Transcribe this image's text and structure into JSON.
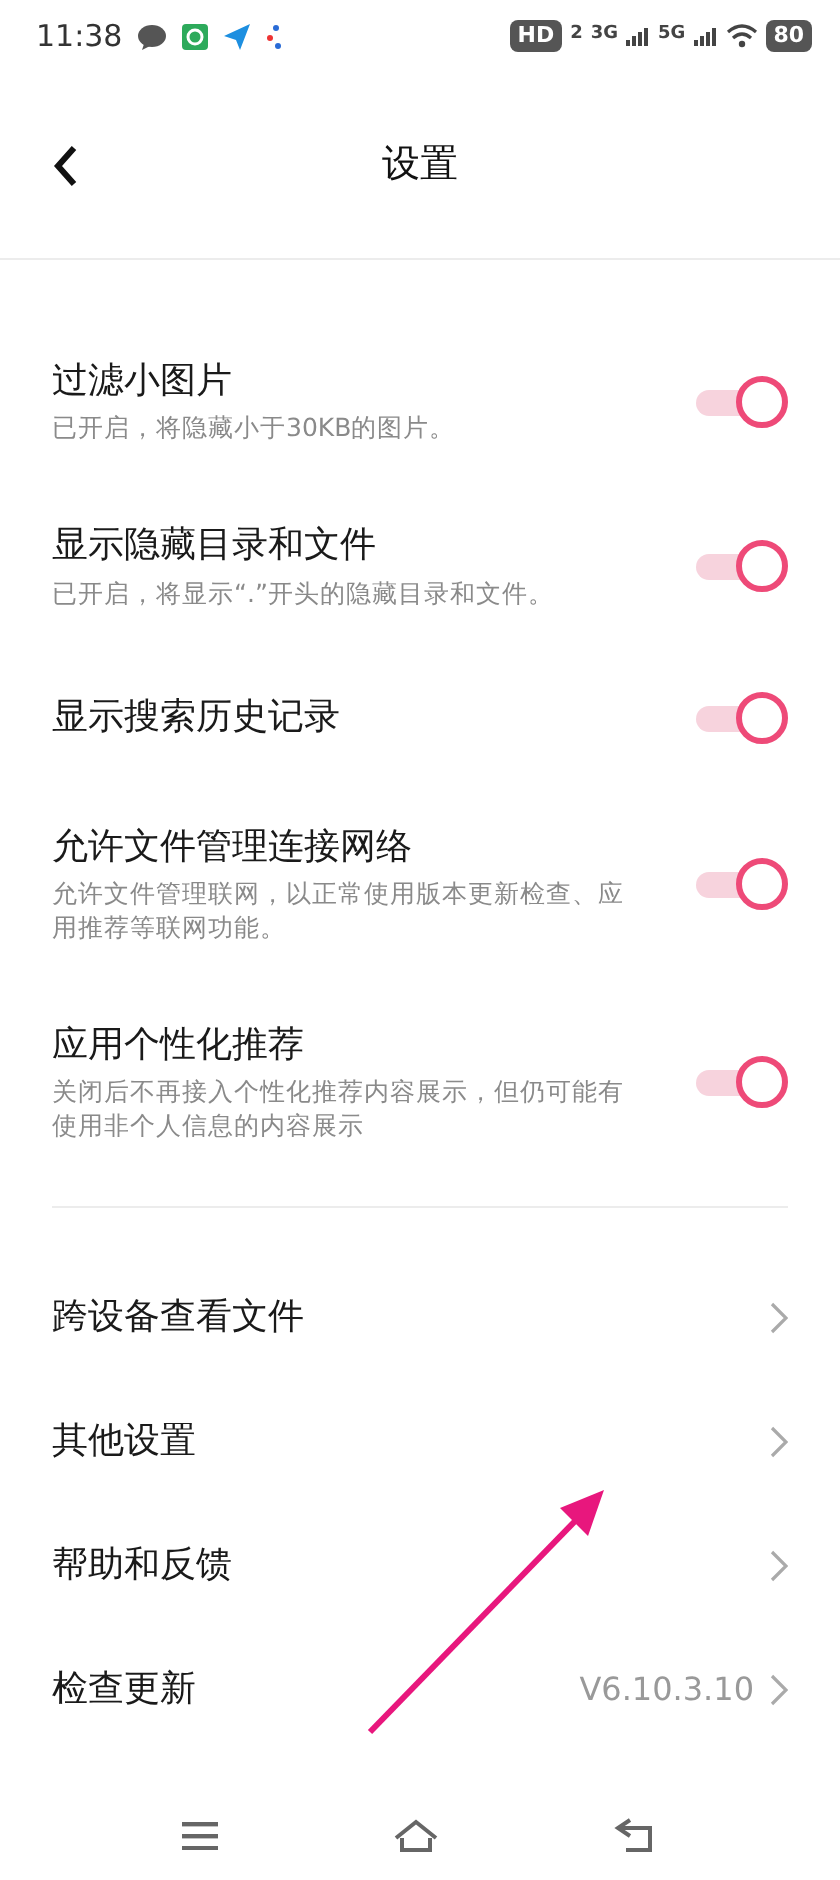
{
  "status_bar": {
    "time": "11:38",
    "hd": "HD",
    "hd_sub": "2",
    "networks": [
      "3G",
      "5G"
    ],
    "battery": "80"
  },
  "header": {
    "title": "设置"
  },
  "toggles": [
    {
      "title": "过滤小图片",
      "subtitle": "已开启，将隐藏小于30KB的图片。",
      "on": true
    },
    {
      "title": "显示隐藏目录和文件",
      "subtitle": "已开启，将显示“.”开头的隐藏目录和文件。",
      "on": true
    },
    {
      "title": "显示搜索历史记录",
      "on": true
    },
    {
      "title": "允许文件管理连接网络",
      "subtitle": "允许文件管理联网，以正常使用版本更新检查、应用推荐等联网功能。",
      "on": true
    },
    {
      "title": "应用个性化推荐",
      "subtitle": "关闭后不再接入个性化推荐内容展示，但仍可能有使用非个人信息的内容展示",
      "on": true
    }
  ],
  "links": [
    {
      "label": "跨设备查看文件"
    },
    {
      "label": "其他设置"
    },
    {
      "label": "帮助和反馈"
    },
    {
      "label": "检查更新",
      "value": "V6.10.3.10"
    }
  ],
  "annotation": {
    "kind": "arrow",
    "color": "#e8177d"
  }
}
